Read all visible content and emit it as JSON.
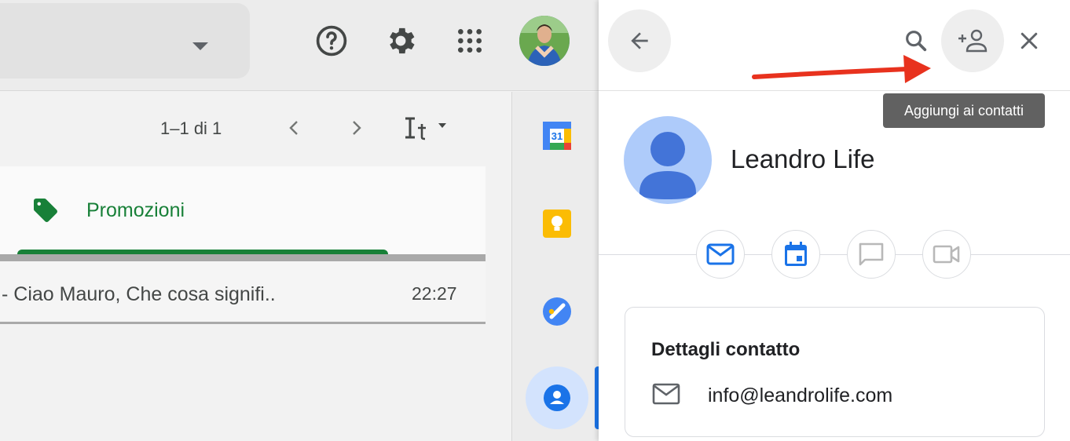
{
  "topbar": {
    "icons": [
      "help-icon",
      "settings-icon",
      "apps-grid-icon",
      "account-avatar"
    ]
  },
  "list_toolbar": {
    "pager_text": "1–1 di 1",
    "icons": [
      "chevron-left-icon",
      "chevron-right-icon",
      "input-tools-icon"
    ]
  },
  "tabs": {
    "active_label": "Promozioni",
    "active_color": "#188038"
  },
  "email_row": {
    "snippet": "- Ciao Mauro, Che cosa signifi..",
    "time": "22:27"
  },
  "rail": {
    "items": [
      "calendar-app-icon",
      "keep-app-icon",
      "tasks-app-icon",
      "contacts-app-icon"
    ],
    "calendar_day": "31"
  },
  "panel": {
    "tooltip": "Aggiungi ai contatti",
    "contact_name": "Leandro Life",
    "actions": [
      "email-icon",
      "calendar-event-icon",
      "chat-icon",
      "video-call-icon"
    ],
    "details_title": "Dettagli contatto",
    "email": "info@leandrolife.com"
  },
  "colors": {
    "accent_blue": "#1a73e8",
    "annotation_red": "#e8321e"
  }
}
